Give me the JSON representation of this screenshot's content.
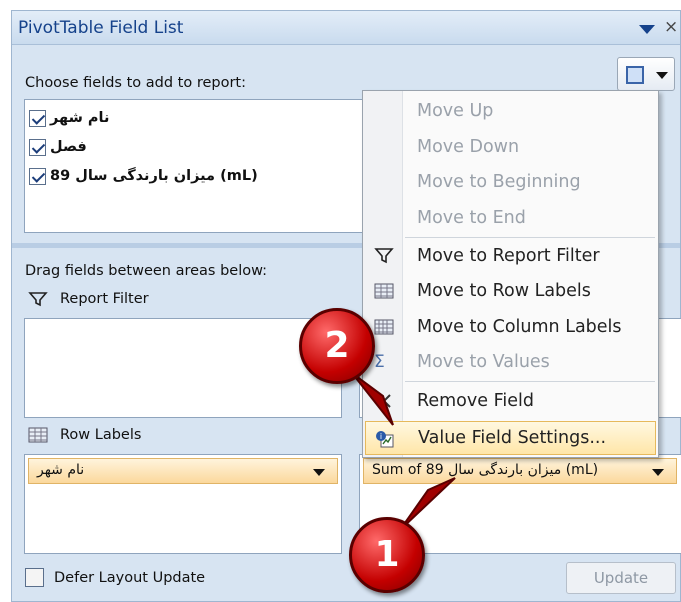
{
  "window": {
    "title": "PivotTable Field List",
    "close_glyph": "×"
  },
  "choose_label": "Choose fields to add to report:",
  "fields": [
    {
      "label": "نام شهر",
      "checked": true
    },
    {
      "label": "فصل",
      "checked": true
    },
    {
      "label": "میزان بارندگی سال 89 (mL)",
      "checked": true
    }
  ],
  "drag_label": "Drag fields between areas below:",
  "areas": {
    "report_filter": {
      "title": "Report Filter",
      "icon": "filter-icon"
    },
    "row_labels": {
      "title": "Row Labels",
      "icon": "table-icon",
      "item": "نام شهر"
    },
    "values": {
      "item": "Sum of 89 میزان بارندگی سال (mL)"
    }
  },
  "context_menu": {
    "items": [
      {
        "label": "Move Up",
        "enabled": false
      },
      {
        "label": "Move Down",
        "enabled": false
      },
      {
        "label": "Move to Beginning",
        "enabled": false
      },
      {
        "label": "Move to End",
        "enabled": false
      },
      {
        "label": "Move to Report Filter",
        "enabled": true,
        "icon": "filter-icon"
      },
      {
        "label": "Move to Row Labels",
        "enabled": true,
        "icon": "row-labels-icon"
      },
      {
        "label": "Move to Column Labels",
        "enabled": true,
        "icon": "column-labels-icon"
      },
      {
        "label": "Move to Values",
        "enabled": false,
        "icon": "sigma-icon"
      },
      {
        "label": "Remove Field",
        "enabled": true,
        "icon": "remove-icon"
      },
      {
        "label": "Value Field Settings...",
        "enabled": true,
        "icon": "field-settings-icon",
        "highlighted": true
      }
    ]
  },
  "defer_label": "Defer Layout Update",
  "update_button": "Update",
  "annotations": {
    "step1": "1",
    "step2": "2"
  },
  "colors": {
    "accent": "#15428b",
    "highlight": "#ffe6a8",
    "badge": "#c40000"
  }
}
